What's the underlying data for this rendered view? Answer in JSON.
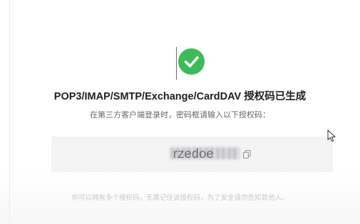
{
  "success": {
    "title": "POP3/IMAP/SMTP/Exchange/CardDAV 授权码已生成",
    "subtitle": "在第三方客户端登录时，密码框请输入以下授权码：",
    "code_visible": "rzedoe",
    "footnote": "你可以拥有多个授权码，无需记住该授权码，为了安全请勿告知其他人。"
  },
  "icons": {
    "status": "check-circle-icon",
    "copy": "copy-icon",
    "cursor": "mouse-pointer-icon"
  },
  "colors": {
    "success_green": "#3dbb59",
    "title_text": "#1f1f1f",
    "code_box_bg": "#f3f3f3",
    "footnote_text": "#c8c8c8"
  }
}
